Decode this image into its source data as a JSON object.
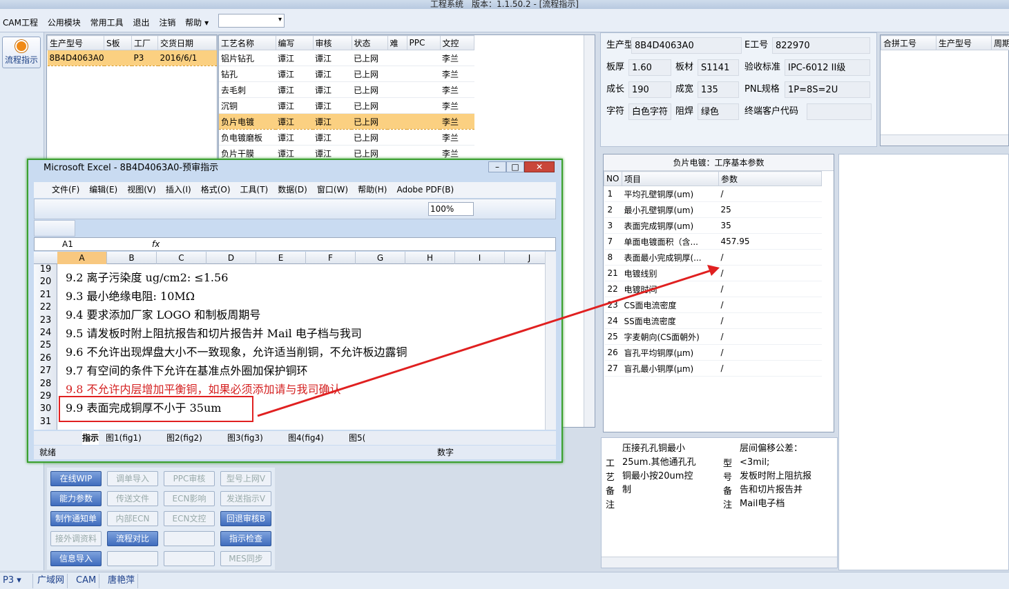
{
  "window": {
    "title": "工程系统　版本：1.1.50.2 - [流程指示]"
  },
  "menu": [
    "CAM工程",
    "公用模块",
    "常用工具",
    "退出",
    "注销",
    "帮助"
  ],
  "nav": {
    "flow_label": "流程指示"
  },
  "left_table": {
    "headers": [
      "生产型号",
      "S板",
      "工厂",
      "交货日期"
    ],
    "row": [
      "8B4D4063A0",
      "",
      "P3",
      "2016/6/1"
    ]
  },
  "proc_table": {
    "headers": [
      "工艺名称",
      "编写",
      "审核",
      "状态",
      "难",
      "PPC",
      "文控"
    ],
    "rows": [
      [
        "铝片钻孔",
        "谭江",
        "谭江",
        "已上网",
        "",
        "",
        "李兰"
      ],
      [
        "钻孔",
        "谭江",
        "谭江",
        "已上网",
        "",
        "",
        "李兰"
      ],
      [
        "去毛刺",
        "谭江",
        "谭江",
        "已上网",
        "",
        "",
        "李兰"
      ],
      [
        "沉铜",
        "谭江",
        "谭江",
        "已上网",
        "",
        "",
        "李兰"
      ],
      [
        "负片电镀",
        "谭江",
        "谭江",
        "已上网",
        "",
        "",
        "李兰"
      ],
      [
        "负电镀磨板",
        "谭江",
        "谭江",
        "已上网",
        "",
        "",
        "李兰"
      ],
      [
        "负片干膜",
        "谭江",
        "谭江",
        "已上网",
        "",
        "",
        "李兰"
      ]
    ],
    "selected": 4
  },
  "info": {
    "model_label": "生产型号",
    "model": "8B4D4063A0",
    "e_label": "E工号",
    "e": "822970",
    "thick_label": "板厚",
    "thick": "1.60",
    "mat_label": "板材",
    "mat": "S1141",
    "std_label": "验收标准",
    "std": "IPC-6012 II级",
    "len_label": "成长",
    "len": "190",
    "wid_label": "成宽",
    "wid": "135",
    "pnl_label": "PNL规格",
    "pnl": "1P=8S=2U",
    "char_label": "字符",
    "char": "白色字符",
    "mask_label": "阻焊",
    "mask": "绿色",
    "cust_label": "终端客户代码",
    "cust": ""
  },
  "merge": {
    "headers": [
      "合拼工号",
      "生产型号",
      "周期"
    ]
  },
  "params": {
    "title": "负片电镀：工序基本参数",
    "headers": [
      "NO",
      "项目",
      "参数"
    ],
    "rows": [
      [
        "1",
        "平均孔壁铜厚(um)",
        "/"
      ],
      [
        "2",
        "最小孔壁铜厚(um)",
        "25"
      ],
      [
        "3",
        "表面完成铜厚(um)",
        "35"
      ],
      [
        "7",
        "单面电镀面积（含...",
        "457.95"
      ],
      [
        "8",
        "表面最小完成铜厚(...",
        "/"
      ],
      [
        "21",
        "电镀线别",
        "/"
      ],
      [
        "22",
        "电镀时间",
        "/"
      ],
      [
        "23",
        "CS面电流密度",
        "/"
      ],
      [
        "24",
        "SS面电流密度",
        "/"
      ],
      [
        "25",
        "字麦朝向(CS面朝外)",
        "/"
      ],
      [
        "26",
        "盲孔平均铜厚(μm)",
        "/"
      ],
      [
        "27",
        "盲孔最小铜厚(μm)",
        "/"
      ]
    ]
  },
  "notes": {
    "craft_label": "工艺备注",
    "craft": [
      "压接孔孔铜最小",
      "25um.其他通孔孔",
      "铜最小按20um控",
      "制"
    ],
    "model_label": "型号备注",
    "model": [
      "层间偏移公差：",
      "<3mil;",
      "发板时附上阻抗报",
      "告和切片报告并",
      "Mail电子档"
    ]
  },
  "buttons": [
    [
      "在线WIP",
      true
    ],
    [
      "调单导入",
      false
    ],
    [
      "PPC审核",
      false
    ],
    [
      "型号上网V",
      false
    ],
    [
      "能力参数",
      true
    ],
    [
      "传送文件",
      false
    ],
    [
      "ECN影响",
      false
    ],
    [
      "发送指示V",
      false
    ],
    [
      "制作通知单",
      true
    ],
    [
      "内部ECN",
      false
    ],
    [
      "ECN文控",
      false
    ],
    [
      "回退审核B",
      true
    ],
    [
      "接外调资料",
      false
    ],
    [
      "流程对比",
      true
    ],
    [
      "",
      false
    ],
    [
      "指示检查",
      true
    ],
    [
      "信息导入",
      true
    ],
    [
      "",
      false
    ],
    [
      "",
      false
    ],
    [
      "MES同步",
      false
    ]
  ],
  "status": {
    "factory": "P3",
    "tabs": [
      "广域网",
      "CAM",
      "唐艳萍"
    ]
  },
  "excel": {
    "title": "Microsoft Excel - 8B4D4063A0-预审指示",
    "menu": [
      "文件(F)",
      "编辑(E)",
      "视图(V)",
      "插入(I)",
      "格式(O)",
      "工具(T)",
      "数据(D)",
      "窗口(W)",
      "帮助(H)",
      "Adobe PDF(B)"
    ],
    "zoom": "100%",
    "cell": "A1",
    "fx": "fx",
    "cols": [
      "A",
      "B",
      "C",
      "D",
      "E",
      "F",
      "G",
      "H",
      "I",
      "J"
    ],
    "rownums": [
      "19",
      "20",
      "21",
      "22",
      "23",
      "24",
      "25",
      "26",
      "27",
      "28",
      "29",
      "30",
      "31"
    ],
    "lines": [
      "9.2 离子污染度 ug/cm2: ≤1.56",
      "9.3 最小绝缘电阻: 10MΩ",
      "9.4 要求添加厂家 LOGO 和制板周期号",
      "9.5 请发板时附上阻抗报告和切片报告并 Mail 电子档与我司",
      "9.6 不允许出现焊盘大小不一致现象，允许适当削铜，不允许板边露铜",
      "9.7 有空间的条件下允许在基准点外圈加保护铜环",
      "9.8 不允许内层增加平衡铜，如果必须添加请与我司确认",
      "9.9 表面完成铜厚不小于 35um"
    ],
    "sheets": [
      "指示",
      "图1(fig1)",
      "图2(fig2)",
      "图3(fig3)",
      "图4(fig4)",
      "图5("
    ],
    "status_left": "就绪",
    "status_num": "数字"
  }
}
